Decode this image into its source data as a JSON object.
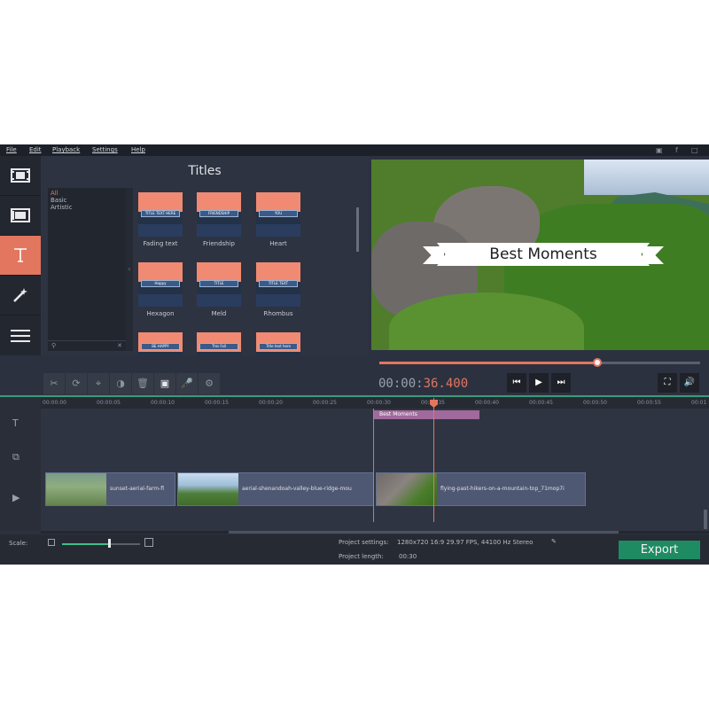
{
  "menu": {
    "items": [
      {
        "label": "File"
      },
      {
        "label": "Edit"
      },
      {
        "label": "Playback"
      },
      {
        "label": "Settings"
      },
      {
        "label": "Help"
      }
    ],
    "right_icons": [
      "cart-icon",
      "facebook-icon",
      "share-icon"
    ]
  },
  "left_tools": [
    {
      "name": "import-media",
      "icon": "film-strip-icon",
      "active": false
    },
    {
      "name": "media-library",
      "icon": "clapperboard-icon",
      "active": false
    },
    {
      "name": "titles",
      "icon": "text-icon",
      "active": true
    },
    {
      "name": "effects",
      "icon": "magic-wand-icon",
      "active": false
    },
    {
      "name": "more",
      "icon": "menu-icon",
      "active": false
    }
  ],
  "titles_panel": {
    "heading": "Titles",
    "categories": [
      {
        "label": "All",
        "selected": true
      },
      {
        "label": "Basic",
        "selected": false
      },
      {
        "label": "Artistic",
        "selected": false
      }
    ],
    "items": [
      {
        "label": "Fading text",
        "preview": "TITLE TEXT HERE"
      },
      {
        "label": "Friendship",
        "preview": "FRIENDSHIP"
      },
      {
        "label": "Heart",
        "preview": "YOU"
      },
      {
        "label": "Hexagon",
        "preview": "Happy"
      },
      {
        "label": "Meld",
        "preview": "TITLE"
      },
      {
        "label": "Rhombus",
        "preview": "TITLE TEXT"
      },
      {
        "label": "",
        "preview": "BE HAPPY"
      },
      {
        "label": "",
        "preview": "This Fall"
      },
      {
        "label": "",
        "preview": "Title text here"
      }
    ]
  },
  "preview": {
    "overlay_title": "Best Moments"
  },
  "playback": {
    "timecode_prefix": "00:00:",
    "timecode_accent": "36.400",
    "progress": 0.68,
    "buttons": [
      "skip-back-icon",
      "play-icon",
      "skip-forward-icon"
    ],
    "right_buttons": [
      "fullscreen-icon",
      "volume-icon"
    ]
  },
  "edit_tools": [
    "cut-icon",
    "rotate-icon",
    "crop-icon",
    "color-icon",
    "delete-icon",
    "image-icon",
    "mic-icon",
    "settings-icon"
  ],
  "timeline": {
    "ticks": [
      "00:00:00",
      "00:00:05",
      "00:00:10",
      "00:00:15",
      "00:00:20",
      "00:00:25",
      "00:00:30",
      "00:00:35",
      "00:00:40",
      "00:00:45",
      "00:00:50",
      "00:00:55",
      "00:01"
    ],
    "title_clip": "Best Moments",
    "video_clips": [
      {
        "name": "sunset-aerial-farm-fl"
      },
      {
        "name": "aerial-shenandoah-valley-blue-ridge-mou"
      },
      {
        "name": "flying-past-hikers-on-a-mountain-top_71mop7i"
      }
    ]
  },
  "bottom": {
    "scale_label": "Scale:",
    "scale_value": 0.6,
    "project_settings_label": "Project settings:",
    "project_settings_value": "1280x720 16:9 29.97 FPS, 44100 Hz Stereo",
    "project_length_label": "Project length:",
    "project_length_value": "00:30",
    "export_label": "Export"
  },
  "colors": {
    "accent": "#e2765f",
    "export": "#1f8b63",
    "title_clip": "#a06a9c",
    "timeline_separator": "#3c9a78"
  }
}
